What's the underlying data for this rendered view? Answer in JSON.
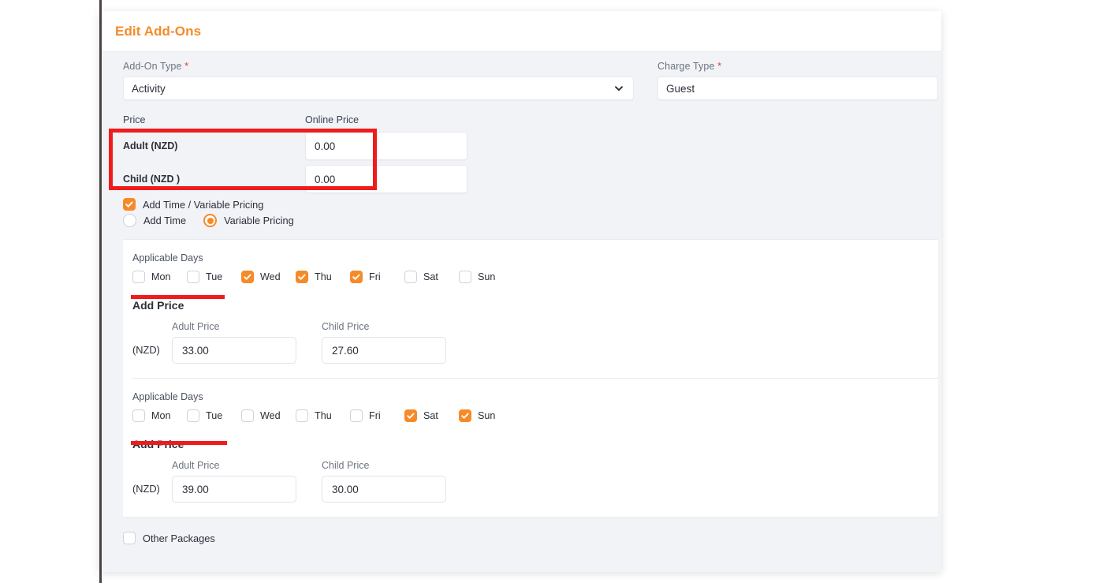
{
  "card": {
    "title": "Edit Add-Ons"
  },
  "accent_color": "#f68a28",
  "annotation_color": "#ee1c1c",
  "top_form": {
    "addon_type": {
      "label": "Add-On Type",
      "required_marker": "*",
      "value": "Activity",
      "icon": "chevron-down-icon"
    },
    "charge_type": {
      "label": "Charge Type",
      "required_marker": "*",
      "value": "Guest"
    }
  },
  "price_table": {
    "col_price": "Price",
    "col_online_price": "Online Price",
    "rows": [
      {
        "name": "Adult (NZD)",
        "online_price": "0.00",
        "price": ""
      },
      {
        "name": "Child (NZD )",
        "online_price": "0.00",
        "price": ""
      }
    ]
  },
  "options": {
    "add_time_variable_pricing": {
      "label": "Add Time / Variable Pricing",
      "checked": true
    },
    "mode": {
      "selected": "Variable Pricing",
      "choices": [
        {
          "label": "Add Time",
          "selected": false
        },
        {
          "label": "Variable Pricing",
          "selected": true
        }
      ]
    }
  },
  "variable_pricing_groups": [
    {
      "applicable_days_label": "Applicable Days",
      "days": [
        {
          "label": "Mon",
          "checked": false
        },
        {
          "label": "Tue",
          "checked": false
        },
        {
          "label": "Wed",
          "checked": true
        },
        {
          "label": "Thu",
          "checked": true
        },
        {
          "label": "Fri",
          "checked": true
        },
        {
          "label": "Sat",
          "checked": false
        },
        {
          "label": "Sun",
          "checked": false
        }
      ],
      "add_price_title": "Add Price",
      "currency": "(NZD)",
      "adult": {
        "label": "Adult Price",
        "value": "33.00"
      },
      "child": {
        "label": "Child Price",
        "value": "27.60"
      }
    },
    {
      "applicable_days_label": "Applicable Days",
      "days": [
        {
          "label": "Mon",
          "checked": false
        },
        {
          "label": "Tue",
          "checked": false
        },
        {
          "label": "Wed",
          "checked": false
        },
        {
          "label": "Thu",
          "checked": false
        },
        {
          "label": "Fri",
          "checked": false
        },
        {
          "label": "Sat",
          "checked": true
        },
        {
          "label": "Sun",
          "checked": true
        }
      ],
      "add_price_title": "Add Price",
      "currency": "(NZD)",
      "adult": {
        "label": "Adult Price",
        "value": "39.00"
      },
      "child": {
        "label": "Child Price",
        "value": "30.00"
      }
    }
  ],
  "footer": {
    "other_packages": {
      "label": "Other Packages",
      "checked": false
    }
  },
  "annotations": [
    {
      "kind": "box",
      "target": "price-rows-highlight"
    },
    {
      "kind": "underline",
      "target": "group-1-mon-tue-underline"
    },
    {
      "kind": "underline",
      "target": "group-2-mon-tue-underline"
    }
  ]
}
